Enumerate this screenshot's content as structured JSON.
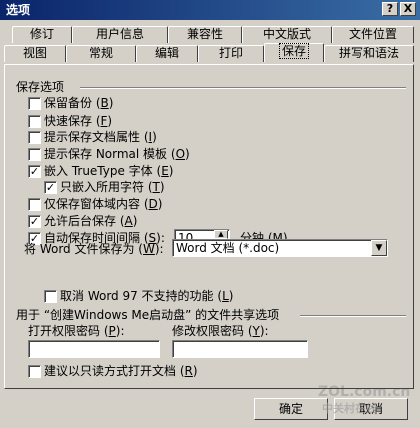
{
  "window": {
    "title": "选项",
    "help_label": "?",
    "close_label": "X"
  },
  "tabs_row1": [
    "修订",
    "用户信息",
    "兼容性",
    "中文版式",
    "文件位置"
  ],
  "tabs_row2": [
    "视图",
    "常规",
    "编辑",
    "打印",
    "保存",
    "拼写和语法"
  ],
  "active_tab": "保存",
  "save_options": {
    "group_title": "保存选项",
    "items": [
      {
        "label": "保留备份",
        "key": "B",
        "checked": false
      },
      {
        "label": "快速保存",
        "key": "F",
        "checked": false
      },
      {
        "label": "提示保存文档属性",
        "key": "I",
        "checked": false
      },
      {
        "label": "提示保存 Normal 模板",
        "key": "O",
        "checked": false
      },
      {
        "label": "嵌入 TrueType 字体",
        "key": "E",
        "checked": true
      },
      {
        "label": "只嵌入所用字符",
        "key": "T",
        "checked": true
      },
      {
        "label": "仅保存窗体域内容",
        "key": "D",
        "checked": false
      },
      {
        "label": "允许后台保存",
        "key": "A",
        "checked": true
      },
      {
        "label": "自动保存时间间隔",
        "key": "S",
        "checked": true
      }
    ],
    "autosave_value": "10",
    "autosave_unit": "分钟",
    "autosave_unit_key": "M",
    "save_as_label": "将 Word 文件保存为",
    "save_as_key": "W",
    "save_as_value": "Word 文档 (*.doc)",
    "disable_w97_label": "取消 Word 97 不支持的功能",
    "disable_w97_key": "L",
    "disable_w97_checked": false
  },
  "sharing": {
    "group_title": "用于 “创建Windows Me启动盘” 的文件共享选项",
    "open_pw_label": "打开权限密码",
    "open_pw_key": "P",
    "open_pw_value": "",
    "modify_pw_label": "修改权限密码",
    "modify_pw_key": "Y",
    "modify_pw_value": "",
    "readonly_label": "建议以只读方式打开文档",
    "readonly_key": "R",
    "readonly_checked": false
  },
  "buttons": {
    "ok": "确定",
    "cancel": "取消"
  },
  "watermark": {
    "text1": "ZOL.com.cn",
    "text2": "中关村在线"
  }
}
